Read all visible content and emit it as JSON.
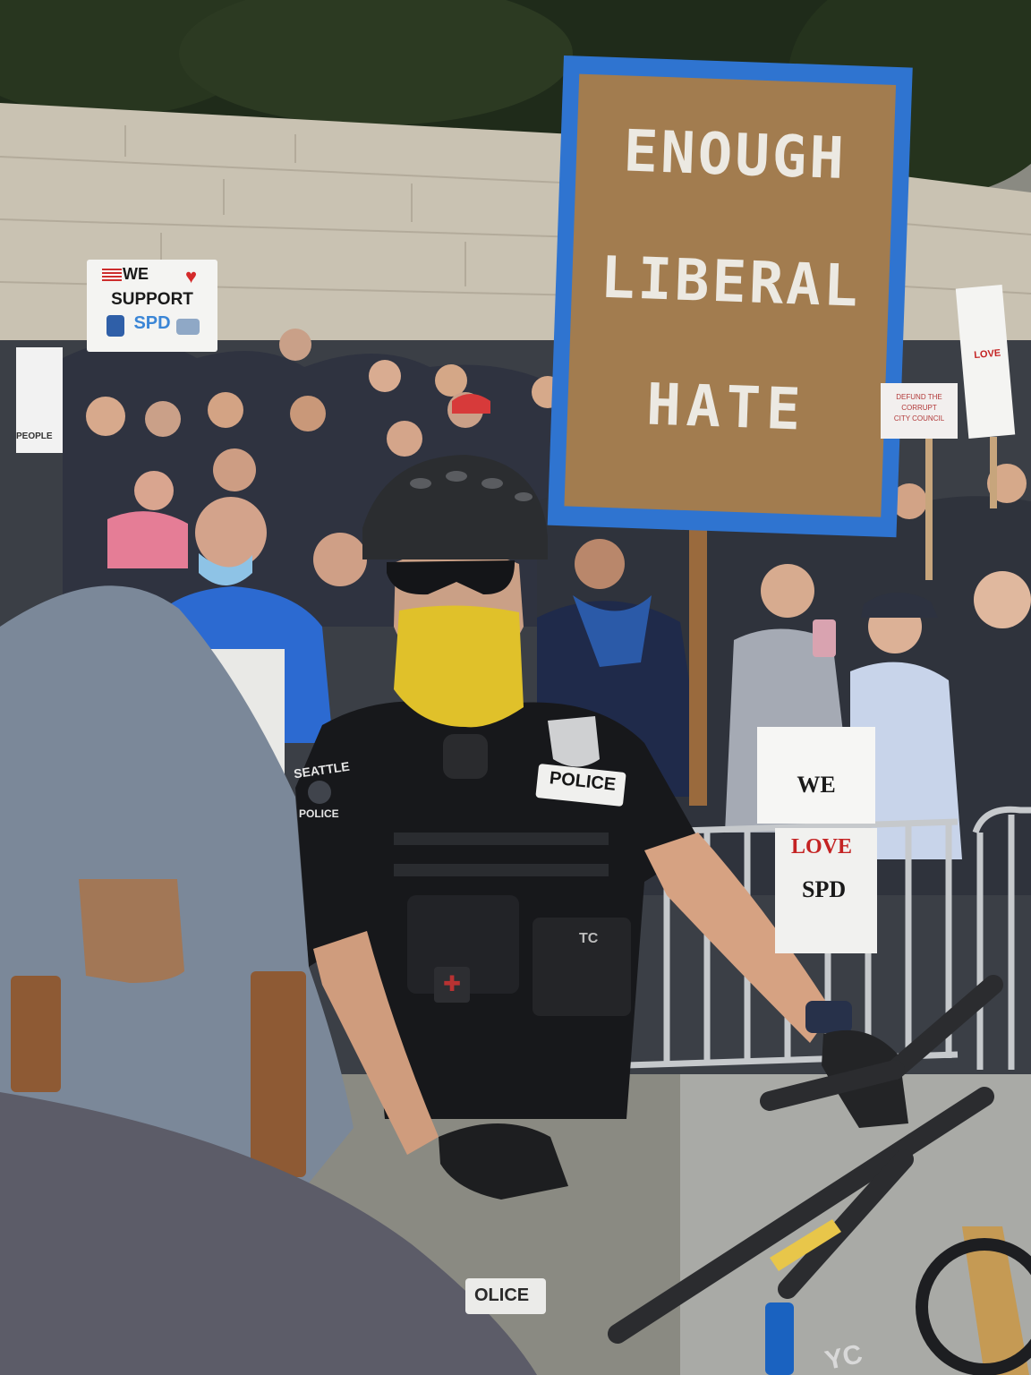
{
  "photo": {
    "signs": {
      "main_sign": {
        "line1": "ENOUGH",
        "line2": "LIBERAL",
        "line3": "HATE",
        "board_color": "#a27c4f",
        "frame_color": "#2f74d0"
      },
      "support_sign": {
        "line1": "WE",
        "line2": "SUPPORT",
        "line3": "SPD"
      },
      "love_sign": {
        "line1": "WE",
        "line2": "LOVE",
        "line3": "SPD",
        "love_color": "#c42323"
      },
      "small_sign_right": {
        "line1": "DEFUND THE",
        "line2": "CORRUPT",
        "line3": "CITY COUNCIL"
      },
      "left_edge_sign_text": "PEOPLE",
      "tall_sign_right_text": "LOVE"
    },
    "officer": {
      "patch_line1": "SEATTLE",
      "patch_line2": "POLICE",
      "chest_label": "POLICE",
      "belt_tag": "TC",
      "lower_label": "OLICE",
      "mask_color": "#e0c12a"
    },
    "bike_decal": "YC",
    "colors": {
      "foliage": "#1f2b1a",
      "wall": "#c9c2b2",
      "road": "#a9aaa6",
      "jacket": "#7b8899"
    }
  }
}
